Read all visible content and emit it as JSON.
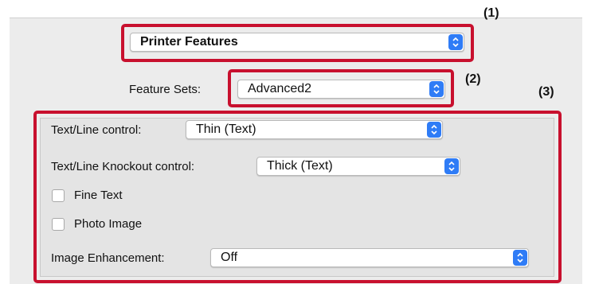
{
  "callouts": [
    "(1)",
    "(2)",
    "(3)"
  ],
  "printer_features": {
    "value": "Printer Features"
  },
  "feature_sets": {
    "label": "Feature Sets:",
    "value": "Advanced2"
  },
  "advanced": {
    "text_line_control": {
      "label": "Text/Line control:",
      "value": "Thin (Text)"
    },
    "knockout_control": {
      "label": "Text/Line Knockout control:",
      "value": "Thick (Text)"
    },
    "fine_text": {
      "label": "Fine Text",
      "checked": false
    },
    "photo_image": {
      "label": "Photo Image",
      "checked": false
    },
    "image_enhancement": {
      "label": "Image Enhancement:",
      "value": "Off"
    }
  },
  "colors": {
    "highlight": "#c8102e",
    "stepper": "#2f7cf6",
    "panel": "#ececec"
  },
  "icons": {
    "stepper": "up-down-chevron-icon"
  }
}
